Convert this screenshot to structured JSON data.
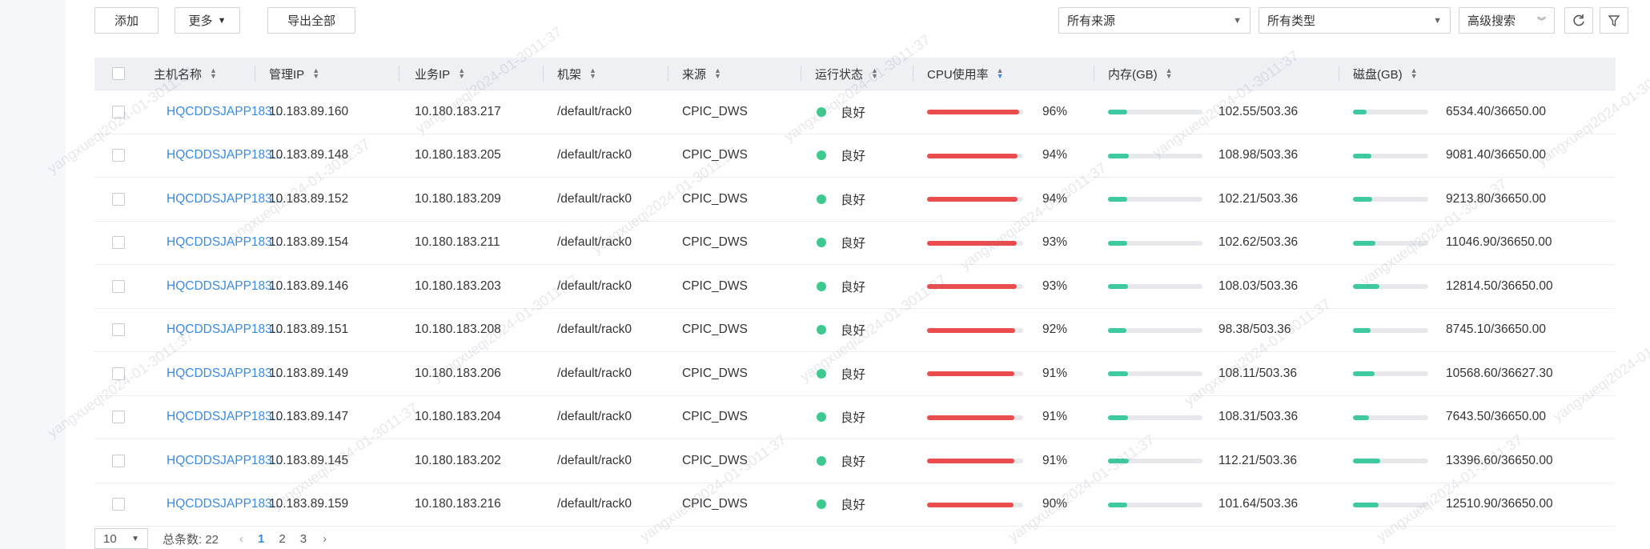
{
  "toolbar": {
    "add_label": "添加",
    "more_label": "更多",
    "export_label": "导出全部",
    "source_filter": "所有来源",
    "type_filter": "所有类型",
    "advanced_search_label": "高级搜索"
  },
  "columns": {
    "hostname": "主机名称",
    "mgmt_ip": "管理IP",
    "service_ip": "业务IP",
    "rack": "机架",
    "source": "来源",
    "status": "运行状态",
    "cpu": "CPU使用率",
    "memory": "内存(GB)",
    "disk": "磁盘(GB)"
  },
  "rows": [
    {
      "host": "HQCDDSJAPP183...",
      "mgmt_ip": "10.183.89.160",
      "service_ip": "10.180.183.217",
      "rack": "/default/rack0",
      "source": "CPIC_DWS",
      "status": "良好",
      "cpu": "96%",
      "cpu_pct": 96,
      "mem": "102.55/503.36",
      "mem_frac": 0.204,
      "disk": "6534.40/36650.00",
      "disk_frac": 0.178
    },
    {
      "host": "HQCDDSJAPP183...",
      "mgmt_ip": "10.183.89.148",
      "service_ip": "10.180.183.205",
      "rack": "/default/rack0",
      "source": "CPIC_DWS",
      "status": "良好",
      "cpu": "94%",
      "cpu_pct": 94,
      "mem": "108.98/503.36",
      "mem_frac": 0.217,
      "disk": "9081.40/36650.00",
      "disk_frac": 0.248
    },
    {
      "host": "HQCDDSJAPP183...",
      "mgmt_ip": "10.183.89.152",
      "service_ip": "10.180.183.209",
      "rack": "/default/rack0",
      "source": "CPIC_DWS",
      "status": "良好",
      "cpu": "94%",
      "cpu_pct": 94,
      "mem": "102.21/503.36",
      "mem_frac": 0.203,
      "disk": "9213.80/36650.00",
      "disk_frac": 0.251
    },
    {
      "host": "HQCDDSJAPP183...",
      "mgmt_ip": "10.183.89.154",
      "service_ip": "10.180.183.211",
      "rack": "/default/rack0",
      "source": "CPIC_DWS",
      "status": "良好",
      "cpu": "93%",
      "cpu_pct": 93,
      "mem": "102.62/503.36",
      "mem_frac": 0.204,
      "disk": "11046.90/36650.00",
      "disk_frac": 0.301
    },
    {
      "host": "HQCDDSJAPP183...",
      "mgmt_ip": "10.183.89.146",
      "service_ip": "10.180.183.203",
      "rack": "/default/rack0",
      "source": "CPIC_DWS",
      "status": "良好",
      "cpu": "93%",
      "cpu_pct": 93,
      "mem": "108.03/503.36",
      "mem_frac": 0.215,
      "disk": "12814.50/36650.00",
      "disk_frac": 0.35
    },
    {
      "host": "HQCDDSJAPP183...",
      "mgmt_ip": "10.183.89.151",
      "service_ip": "10.180.183.208",
      "rack": "/default/rack0",
      "source": "CPIC_DWS",
      "status": "良好",
      "cpu": "92%",
      "cpu_pct": 92,
      "mem": "98.38/503.36",
      "mem_frac": 0.195,
      "disk": "8745.10/36650.00",
      "disk_frac": 0.239
    },
    {
      "host": "HQCDDSJAPP183...",
      "mgmt_ip": "10.183.89.149",
      "service_ip": "10.180.183.206",
      "rack": "/default/rack0",
      "source": "CPIC_DWS",
      "status": "良好",
      "cpu": "91%",
      "cpu_pct": 91,
      "mem": "108.11/503.36",
      "mem_frac": 0.215,
      "disk": "10568.60/36627.30",
      "disk_frac": 0.289
    },
    {
      "host": "HQCDDSJAPP183...",
      "mgmt_ip": "10.183.89.147",
      "service_ip": "10.180.183.204",
      "rack": "/default/rack0",
      "source": "CPIC_DWS",
      "status": "良好",
      "cpu": "91%",
      "cpu_pct": 91,
      "mem": "108.31/503.36",
      "mem_frac": 0.215,
      "disk": "7643.50/36650.00",
      "disk_frac": 0.209
    },
    {
      "host": "HQCDDSJAPP183...",
      "mgmt_ip": "10.183.89.145",
      "service_ip": "10.180.183.202",
      "rack": "/default/rack0",
      "source": "CPIC_DWS",
      "status": "良好",
      "cpu": "91%",
      "cpu_pct": 91,
      "mem": "112.21/503.36",
      "mem_frac": 0.223,
      "disk": "13396.60/36650.00",
      "disk_frac": 0.366
    },
    {
      "host": "HQCDDSJAPP183...",
      "mgmt_ip": "10.183.89.159",
      "service_ip": "10.180.183.216",
      "rack": "/default/rack0",
      "source": "CPIC_DWS",
      "status": "良好",
      "cpu": "90%",
      "cpu_pct": 90,
      "mem": "101.64/503.36",
      "mem_frac": 0.202,
      "disk": "12510.90/36650.00",
      "disk_frac": 0.341
    }
  ],
  "pagination": {
    "page_size": "10",
    "total_label": "总条数: 22",
    "pages": [
      "1",
      "2",
      "3"
    ],
    "current_page": "1"
  },
  "watermark": "yangxueqi2024-01-3011:37",
  "colors": {
    "link": "#3a8be0",
    "cpu_bar": "#ea4d4d",
    "usage_bar": "#3ec9a0",
    "status_ok": "#3ec98f"
  }
}
